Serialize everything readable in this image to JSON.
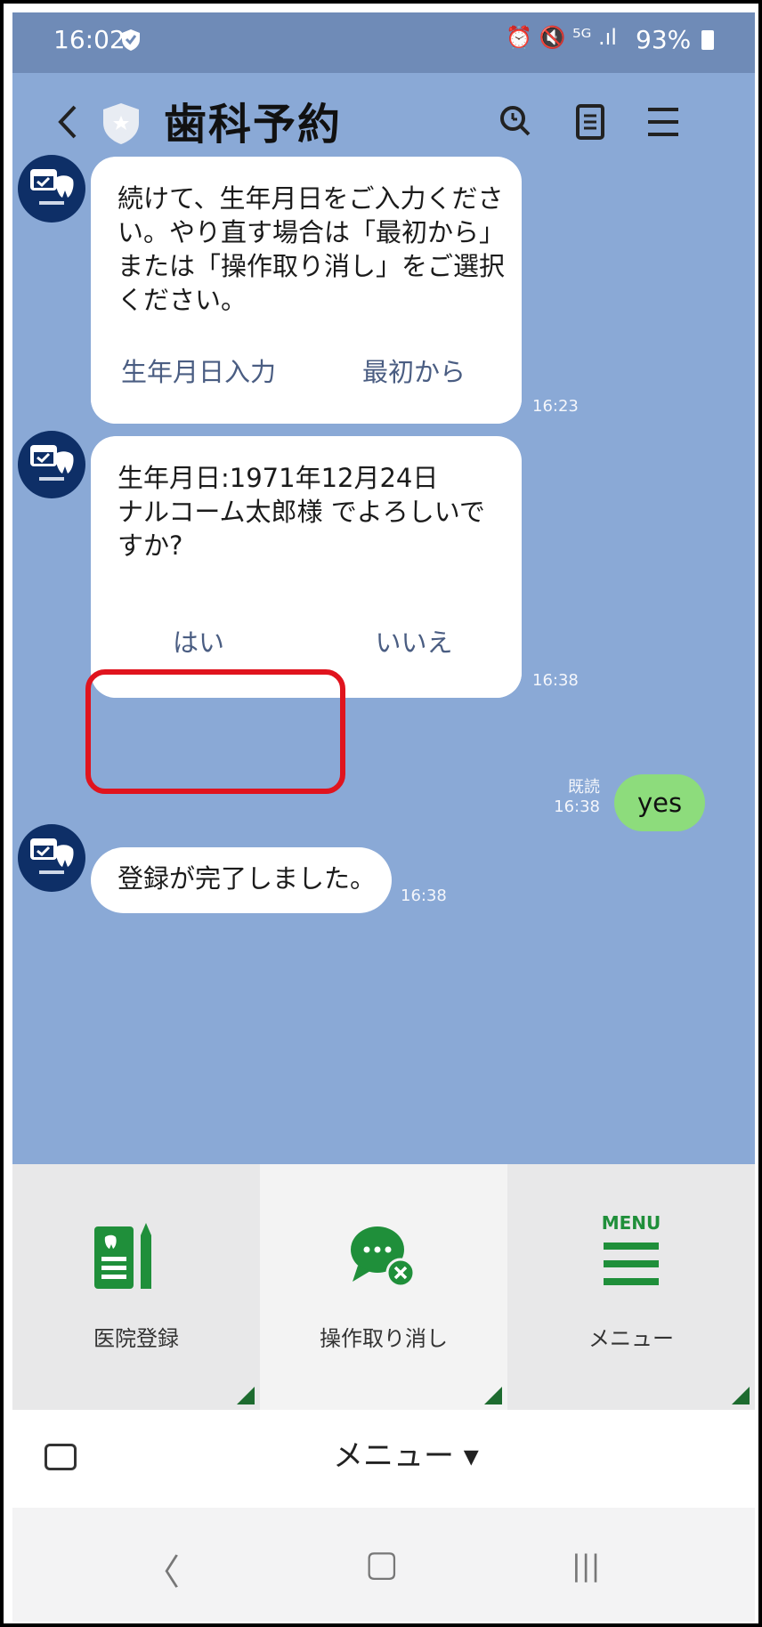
{
  "status_bar": {
    "time": "16:02",
    "icons_text": "⏰ 🔇 ⁵ᴳ .ıl",
    "battery": "93%"
  },
  "header": {
    "title": "歯科予約",
    "back_icon": "chevron-left-icon",
    "search_icon": "search-icon",
    "notes_icon": "notes-icon",
    "menu_icon": "hamburger-icon"
  },
  "messages": [
    {
      "text": "続けて、生年月日をご入力くださ\nい。やり直す場合は「最初から」\nまたは「操作取り消し」をご選択\nください。",
      "actions": [
        "生年月日入力",
        "最初から"
      ],
      "time": "16:23"
    },
    {
      "text": "生年月日:1971年12月24日\nナルコーム太郎様 でよろしいで\nすか?",
      "actions": [
        "はい",
        "いいえ"
      ],
      "time": "16:38"
    },
    {
      "text": "登録が完了しました。",
      "time": "16:38"
    }
  ],
  "user_message": {
    "text": "yes",
    "read_label": "既読",
    "time": "16:38"
  },
  "rich_menu": {
    "items": [
      {
        "label": "医院登録",
        "icon": "clinic-register-icon"
      },
      {
        "label": "操作取り消し",
        "icon": "cancel-operation-icon"
      },
      {
        "label": "メニュー",
        "icon_text": "MENU",
        "icon": "menu-lines-icon"
      }
    ]
  },
  "input_bar": {
    "menu_toggle": "メニュー ▾"
  },
  "nav_bar": {
    "back": "〈",
    "home": "▢",
    "recents": "|||"
  },
  "colors": {
    "chat_bg": "#8aa9d6",
    "header_bg": "#6f8bb7",
    "avatar_bg": "#0e2f67",
    "user_bubble": "#8ddc7c",
    "highlight": "#e0141e",
    "menu_green": "#1d6b2f"
  }
}
